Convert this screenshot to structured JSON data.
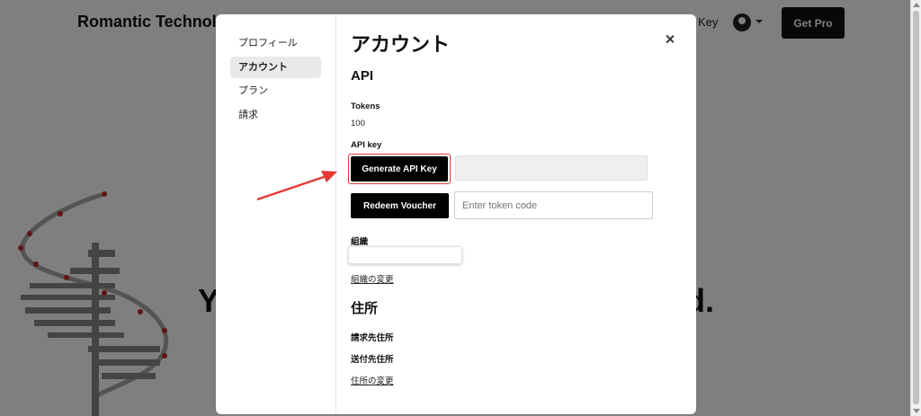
{
  "background": {
    "header_title": "Romantic Technol",
    "key_fragment": "Key",
    "get_pro_label": "Get Pro",
    "big_text_left": "Y",
    "big_text_right": "d."
  },
  "modal": {
    "nav": [
      {
        "label": "プロフィール",
        "active": false
      },
      {
        "label": "アカウント",
        "active": true
      },
      {
        "label": "プラン",
        "active": false
      },
      {
        "label": "請求",
        "active": false
      }
    ],
    "title": "アカウント",
    "api": {
      "heading": "API",
      "tokens_label": "Tokens",
      "tokens_value": "100",
      "api_key_label": "API key",
      "generate_label": "Generate API Key",
      "api_key_value": "",
      "redeem_label": "Redeem Voucher",
      "voucher_placeholder": "Enter token code"
    },
    "organization": {
      "label": "組織",
      "value": "",
      "change_link": "組織の変更"
    },
    "address": {
      "heading": "住所",
      "billing_label": "請求先住所",
      "shipping_label": "送付先住所",
      "change_link": "住所の変更"
    }
  },
  "colors": {
    "highlight": "#e53935",
    "primary_button": "#000000",
    "overlay": "rgba(0,0,0,0.5)"
  }
}
